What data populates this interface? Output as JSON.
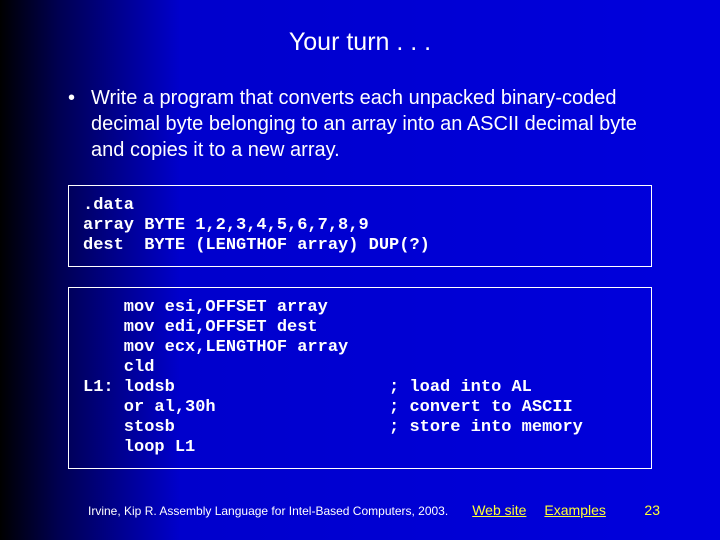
{
  "title": "Your turn . . .",
  "bullet": {
    "marker": "•",
    "text": "Write a program that converts each unpacked binary-coded decimal byte belonging to an array into an ASCII decimal byte and copies it to a new array."
  },
  "code1": ".data\narray BYTE 1,2,3,4,5,6,7,8,9\ndest  BYTE (LENGTHOF array) DUP(?)",
  "code2": "    mov esi,OFFSET array\n    mov edi,OFFSET dest\n    mov ecx,LENGTHOF array\n    cld\nL1: lodsb                     ; load into AL\n    or al,30h                 ; convert to ASCII\n    stosb                     ; store into memory\n    loop L1",
  "footer": {
    "citation": "Irvine, Kip R. Assembly Language for Intel-Based Computers, 2003.",
    "link1": "Web site",
    "link2": "Examples",
    "page": "23"
  }
}
